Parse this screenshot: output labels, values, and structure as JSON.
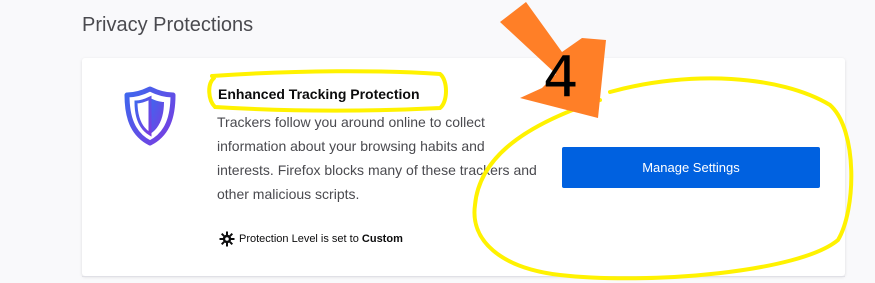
{
  "section": {
    "title": "Privacy Protections"
  },
  "card": {
    "title": "Enhanced Tracking Protection",
    "description": "Trackers follow you around online to collect information about your browsing habits and interests. Firefox blocks many of these trackers and other malicious scripts.",
    "button_label": "Manage Settings",
    "protection_prefix": "Protection Level is set to ",
    "protection_value": "Custom"
  },
  "annotation": {
    "step_number": "4",
    "highlight_color": "#fff200",
    "arrow_color": "#ff7f27"
  },
  "colors": {
    "accent": "#0061e0",
    "shield_purple": "#5b3bd6",
    "shield_blue": "#3d68ee"
  }
}
